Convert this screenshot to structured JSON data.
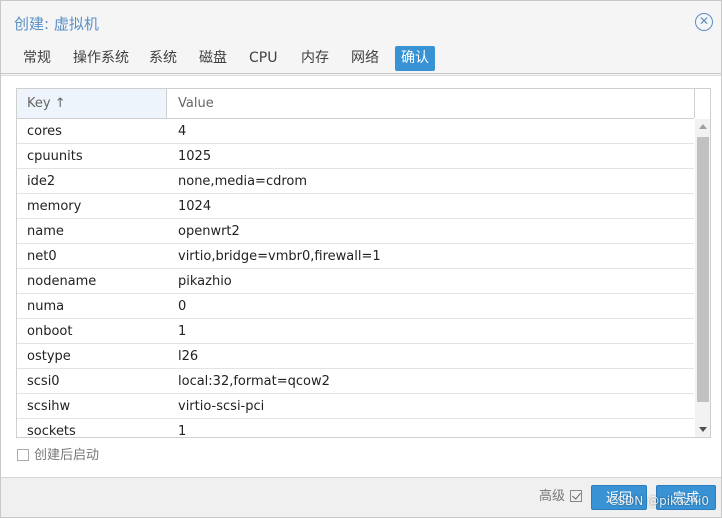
{
  "window": {
    "title": "创建: 虚拟机",
    "close_icon": "close-icon"
  },
  "tabs": [
    {
      "label": "常规"
    },
    {
      "label": "操作系统"
    },
    {
      "label": "系统"
    },
    {
      "label": "磁盘"
    },
    {
      "label": "CPU"
    },
    {
      "label": "内存"
    },
    {
      "label": "网络"
    },
    {
      "label": "确认",
      "active": true
    }
  ],
  "grid": {
    "columns": {
      "key": "Key ↑",
      "value": "Value"
    },
    "rows": [
      {
        "key": "cores",
        "value": "4"
      },
      {
        "key": "cpuunits",
        "value": "1025"
      },
      {
        "key": "ide2",
        "value": "none,media=cdrom"
      },
      {
        "key": "memory",
        "value": "1024"
      },
      {
        "key": "name",
        "value": "openwrt2"
      },
      {
        "key": "net0",
        "value": "virtio,bridge=vmbr0,firewall=1"
      },
      {
        "key": "nodename",
        "value": "pikazhio"
      },
      {
        "key": "numa",
        "value": "0"
      },
      {
        "key": "onboot",
        "value": "1"
      },
      {
        "key": "ostype",
        "value": "l26"
      },
      {
        "key": "scsi0",
        "value": "local:32,format=qcow2"
      },
      {
        "key": "scsihw",
        "value": "virtio-scsi-pci"
      },
      {
        "key": "sockets",
        "value": "1"
      }
    ]
  },
  "start_after_created": {
    "label": "创建后启动",
    "checked": false
  },
  "footer": {
    "advanced_label": "高级",
    "advanced_checked": true,
    "back_label": "返回",
    "finish_label": "完成",
    "watermark": "CSDN @pikazhi0"
  },
  "colors": {
    "accent": "#3892d4",
    "title": "#5a8fc6"
  }
}
